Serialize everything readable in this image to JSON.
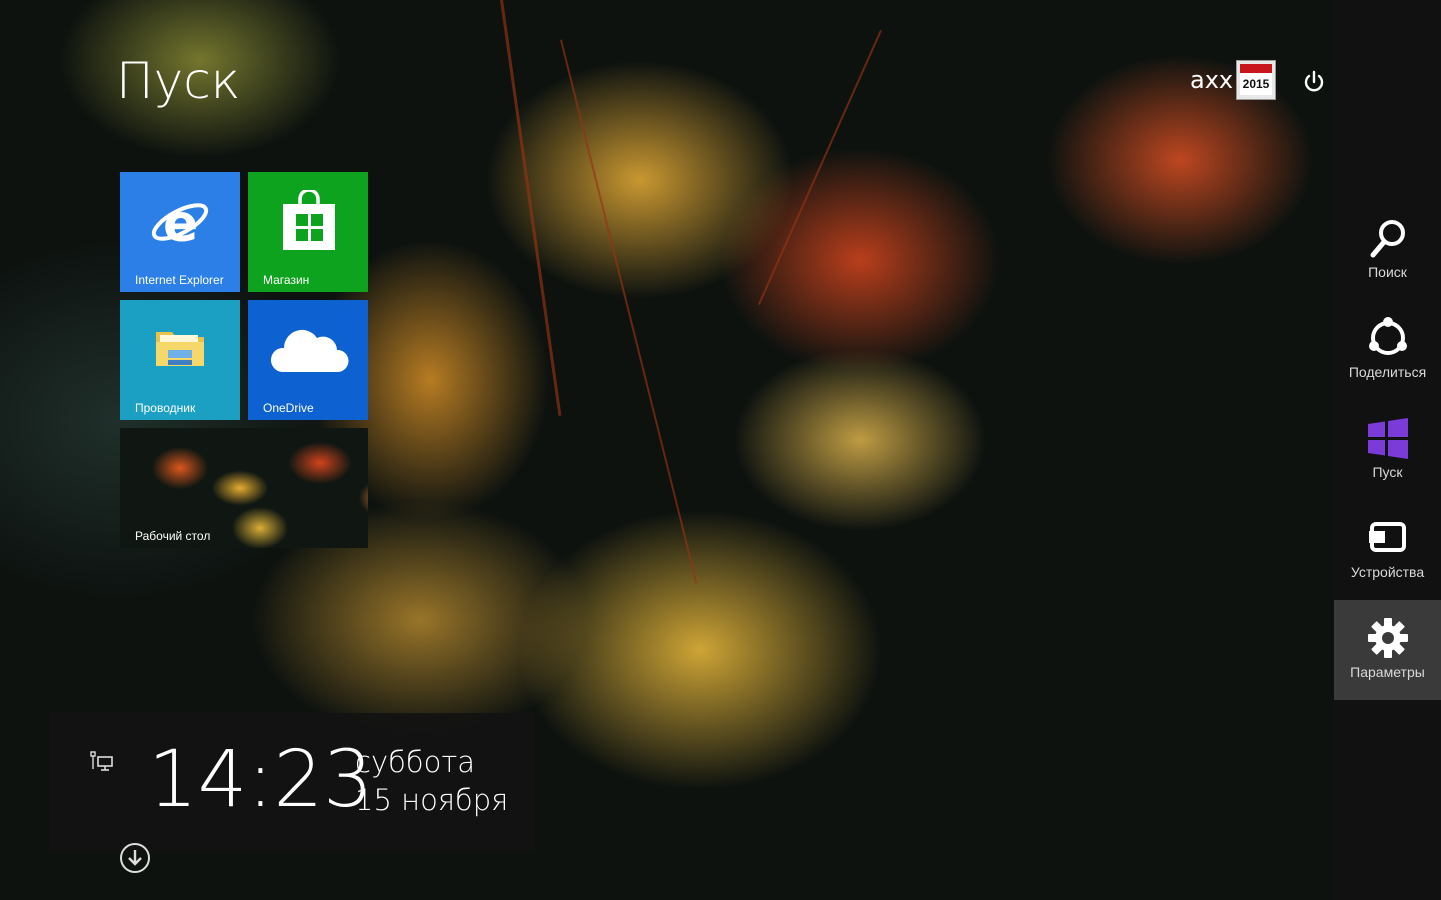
{
  "start": {
    "title": "Пуск"
  },
  "user": {
    "name": "axx",
    "avatar_text": "2015"
  },
  "tiles": [
    {
      "label": "Internet Explorer",
      "color": "#2b7fe6",
      "icon": "internet-explorer-icon"
    },
    {
      "label": "Магазин",
      "color": "#0ea31f",
      "icon": "store-bag-icon"
    },
    {
      "label": "Проводник",
      "color": "#1b9fc2",
      "icon": "folder-icon"
    },
    {
      "label": "OneDrive",
      "color": "#0e61d0",
      "icon": "cloud-icon"
    },
    {
      "label": "Рабочий стол",
      "color": "#101712",
      "icon": "desktop-wallpaper"
    }
  ],
  "clock": {
    "time": "14:23",
    "day": "суббота",
    "date": "15 ноября"
  },
  "charms": [
    {
      "label": "Поиск",
      "icon": "search-icon"
    },
    {
      "label": "Поделиться",
      "icon": "share-icon"
    },
    {
      "label": "Пуск",
      "icon": "windows-logo-icon",
      "accent": "#7a3bd8"
    },
    {
      "label": "Устройства",
      "icon": "devices-icon"
    },
    {
      "label": "Параметры",
      "icon": "settings-gear-icon",
      "selected": true
    }
  ]
}
